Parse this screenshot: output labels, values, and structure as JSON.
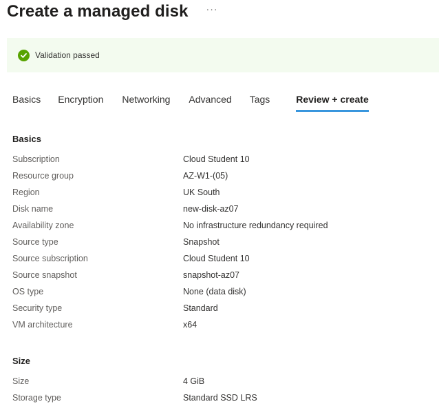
{
  "header": {
    "title": "Create a managed disk",
    "more_label": "···"
  },
  "validation": {
    "text": "Validation passed",
    "status_color": "#57a300",
    "icon": "check-circle-icon"
  },
  "tabs": [
    {
      "label": "Basics",
      "active": false
    },
    {
      "label": "Encryption",
      "active": false
    },
    {
      "label": "Networking",
      "active": false
    },
    {
      "label": "Advanced",
      "active": false
    },
    {
      "label": "Tags",
      "active": false
    },
    {
      "label": "Review + create",
      "active": true
    }
  ],
  "accent_color": "#0078d4",
  "sections": {
    "basics": {
      "heading": "Basics",
      "rows": [
        {
          "label": "Subscription",
          "value": "Cloud Student 10"
        },
        {
          "label": "Resource group",
          "value": "AZ-W1-(05)"
        },
        {
          "label": "Region",
          "value": "UK South"
        },
        {
          "label": "Disk name",
          "value": "new-disk-az07"
        },
        {
          "label": "Availability zone",
          "value": "No infrastructure redundancy required"
        },
        {
          "label": "Source type",
          "value": "Snapshot"
        },
        {
          "label": "Source subscription",
          "value": "Cloud Student 10"
        },
        {
          "label": "Source snapshot",
          "value": "snapshot-az07"
        },
        {
          "label": "OS type",
          "value": "None (data disk)"
        },
        {
          "label": "Security type",
          "value": "Standard"
        },
        {
          "label": "VM architecture",
          "value": "x64"
        }
      ]
    },
    "size": {
      "heading": "Size",
      "rows": [
        {
          "label": "Size",
          "value": "4 GiB"
        },
        {
          "label": "Storage type",
          "value": "Standard SSD LRS"
        }
      ]
    }
  }
}
